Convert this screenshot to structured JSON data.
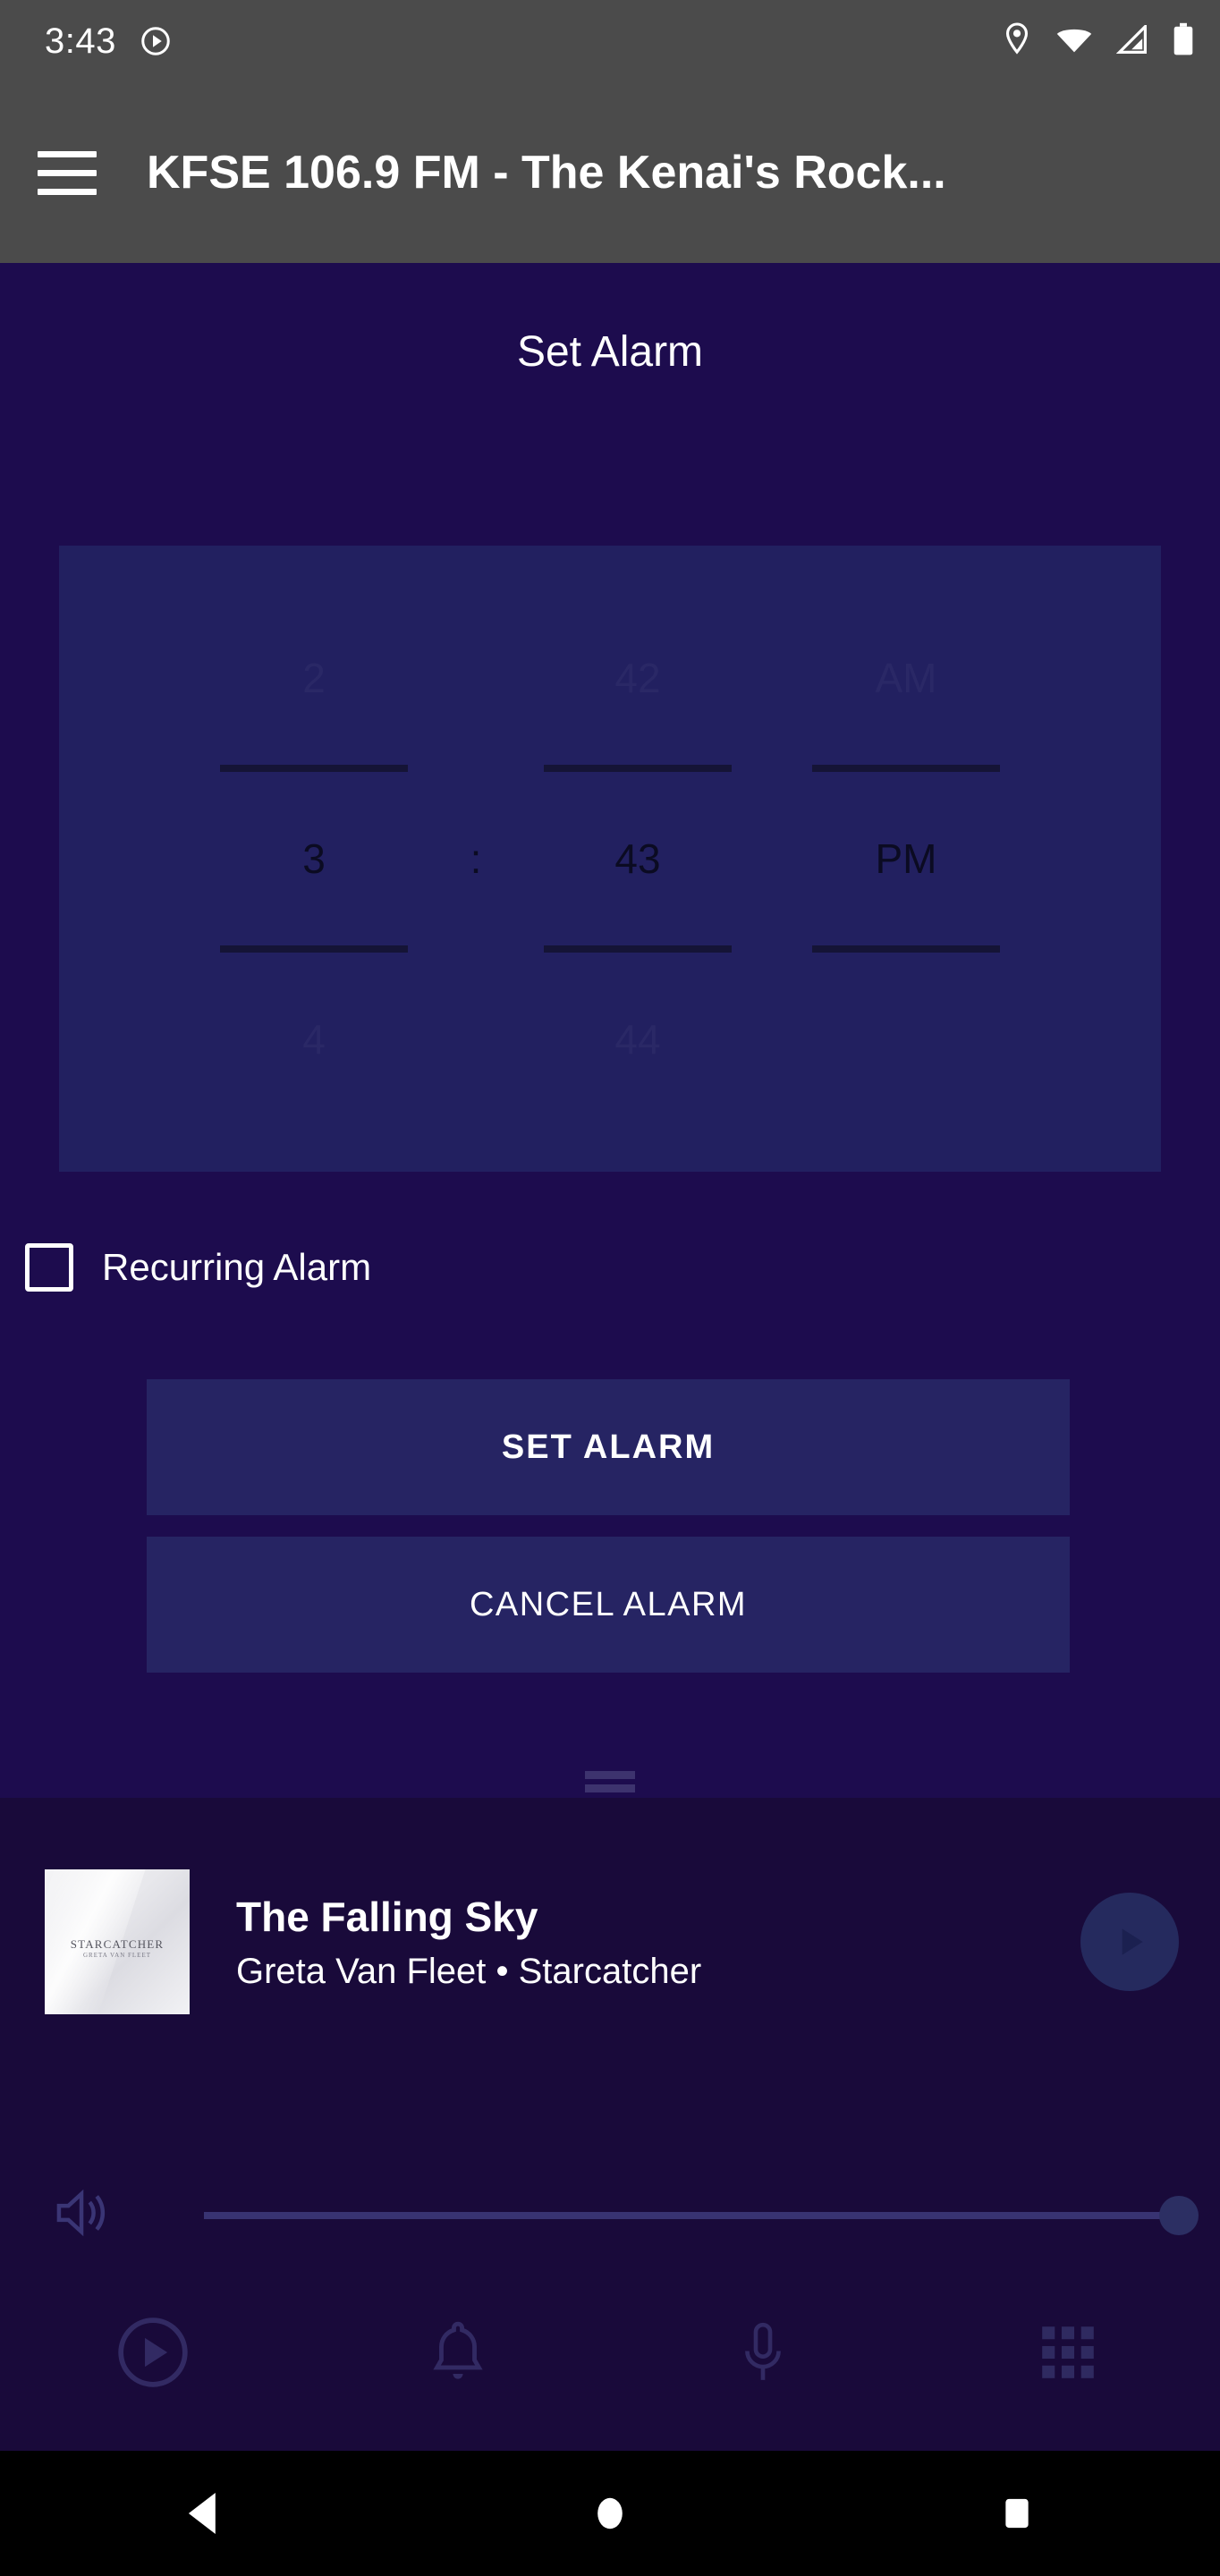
{
  "status_bar": {
    "time": "3:43",
    "icons": [
      "play-circle-icon",
      "location-pin-icon",
      "wifi-icon",
      "cellular-signal-icon",
      "battery-icon"
    ]
  },
  "app_bar": {
    "menu_icon": "hamburger-menu-icon",
    "title": "KFSE 106.9 FM - The Kenai's Rock..."
  },
  "main": {
    "page_title": "Set Alarm",
    "time_picker": {
      "hour": {
        "previous": "2",
        "selected": "3",
        "next": "4"
      },
      "separator": ":",
      "minute": {
        "previous": "42",
        "selected": "43",
        "next": "44"
      },
      "meridiem": {
        "previous": "AM",
        "selected": "PM",
        "next": ""
      }
    },
    "recurring": {
      "label": "Recurring Alarm",
      "checked": false
    },
    "buttons": {
      "set": "SET ALARM",
      "cancel": "CANCEL ALARM"
    }
  },
  "now_playing": {
    "drag_handle": "drag-handle",
    "album_art": {
      "title": "STARCATCHER",
      "artist": "GRETA VAN FLEET"
    },
    "track_title": "The Falling Sky",
    "track_subtitle": "Greta Van Fleet • Starcatcher",
    "play_button_icon": "play-icon",
    "volume": {
      "icon": "speaker-volume-icon",
      "level": 100
    },
    "nav_items": [
      {
        "name": "play-circle-icon"
      },
      {
        "name": "alarm-bell-icon"
      },
      {
        "name": "microphone-icon"
      },
      {
        "name": "grid-apps-icon"
      }
    ]
  },
  "android_nav": {
    "back": "back-triangle-icon",
    "home": "home-circle-icon",
    "recents": "recents-square-icon"
  },
  "colors": {
    "page_bg": "#1d0c4e",
    "toolbar_bg": "#4b4b4b",
    "picker_bg": "#222060",
    "button_bg": "#262463",
    "nowplaying_bg": "#190a3a",
    "accent_text": "#ffffff"
  }
}
